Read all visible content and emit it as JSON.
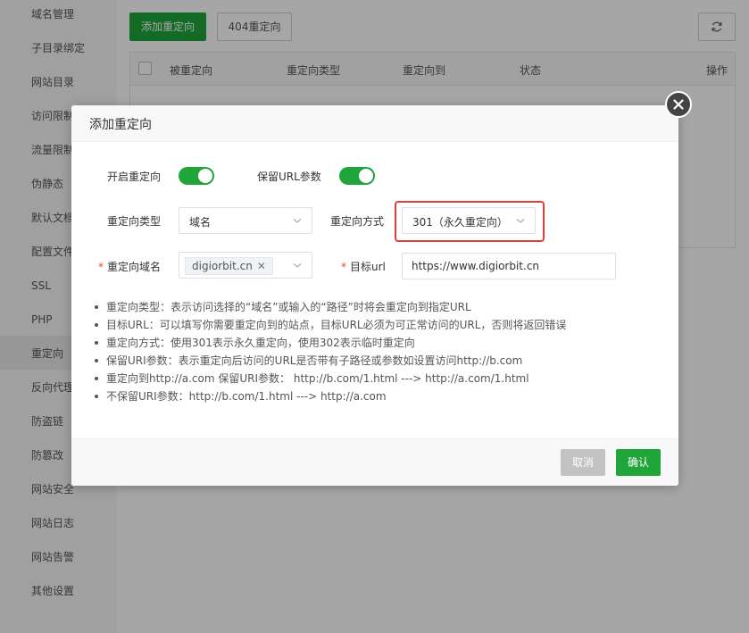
{
  "sidebar": {
    "items": [
      "域名管理",
      "子目录绑定",
      "网站目录",
      "访问限制",
      "流量限制",
      "伪静态",
      "默认文档",
      "配置文件",
      "SSL",
      "PHP",
      "重定向",
      "反向代理",
      "防盗链",
      "防篡改",
      "网站安全",
      "网站日志",
      "网站告警",
      "其他设置"
    ],
    "active": "重定向"
  },
  "toolbar": {
    "add_label": "添加重定向",
    "redirect_404_label": "404重定向",
    "refresh_icon": "refresh-icon"
  },
  "table": {
    "headers": [
      "被重定向",
      "重定向类型",
      "重定向到",
      "状态",
      "操作"
    ]
  },
  "dialog": {
    "title": "添加重定向",
    "enable_label": "开启重定向",
    "enable_on": true,
    "keep_url_label": "保留URL参数",
    "keep_url_on": true,
    "type_label": "重定向类型",
    "type_value": "域名",
    "method_label": "重定向方式",
    "method_value": "301（永久重定向）",
    "domain_label": "重定向域名",
    "domain_tag": "digiorbit.cn",
    "target_label": "目标url",
    "target_value": "https://www.digiorbit.cn",
    "tips": [
      "重定向类型：表示访问选择的“域名”或输入的“路径”时将会重定向到指定URL",
      "目标URL：可以填写你需要重定向到的站点，目标URL必须为可正常访问的URL，否则将返回错误",
      "重定向方式：使用301表示永久重定向，使用302表示临时重定向",
      "保留URI参数：表示重定向后访问的URL是否带有子路径或参数如设置访问http://b.com",
      "重定向到http://a.com 保留URI参数：  http://b.com/1.html ---> http://a.com/1.html",
      "不保留URI参数：http://b.com/1.html ---> http://a.com"
    ],
    "cancel_label": "取消",
    "confirm_label": "确认"
  },
  "colors": {
    "primary": "#20a53a",
    "highlight": "#e0403a"
  }
}
